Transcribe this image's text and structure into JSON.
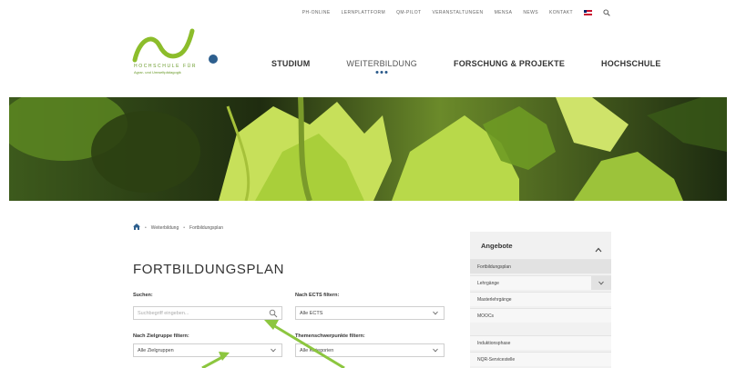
{
  "topbar": {
    "links": [
      "PH-ONLINE",
      "LERNPLATTFORM",
      "QM-PILOT",
      "VERANSTALTUNGEN",
      "MENSA",
      "NEWS",
      "KONTAKT"
    ],
    "language_flag": "uk-flag-icon",
    "search_icon": "search-icon"
  },
  "logo": {
    "line1": "HOCHSCHULE FÜR",
    "line2": "Agrar- und Umweltpädagogik",
    "colors": {
      "green": "#8cbd2b",
      "blue": "#2d5f8e"
    }
  },
  "nav": {
    "items": [
      {
        "label": "STUDIUM",
        "active": false
      },
      {
        "label": "WEITERBILDUNG",
        "active": true
      },
      {
        "label": "FORSCHUNG & PROJEKTE",
        "active": false
      },
      {
        "label": "HOCHSCHULE",
        "active": false
      }
    ]
  },
  "hero": {
    "description_icon": "vine-leaves-banner"
  },
  "breadcrumb": {
    "home_icon": "home-icon",
    "items": [
      "Weiterbildung",
      "Fortbildungsplan"
    ]
  },
  "page": {
    "title": "FORTBILDUNGSPLAN"
  },
  "filters": {
    "search": {
      "label": "Suchen:",
      "placeholder": "Suchbegriff eingeben..."
    },
    "ects": {
      "label": "Nach ECTS filtern:",
      "value": "Alle ECTS"
    },
    "zielgruppe": {
      "label": "Nach Zielgruppe filtern:",
      "value": "Alle Zielgruppen"
    },
    "themen": {
      "label": "Themenschwerpunkte filtern:",
      "value": "Alle Kategorien"
    }
  },
  "sidebar": {
    "title": "Angebote",
    "items": [
      {
        "label": "Fortbildungsplan",
        "active": true
      },
      {
        "label": "Lehrgänge",
        "expandable": true
      },
      {
        "label": "Masterlehrgänge"
      },
      {
        "label": "MOOCs"
      },
      {
        "label": "Induktionsphase"
      },
      {
        "label": "NQR-Servicestelle"
      }
    ]
  },
  "colors": {
    "accent_green": "#8cbd2b",
    "accent_blue": "#2d5f8e",
    "annotation_arrow": "#8cc63f"
  }
}
